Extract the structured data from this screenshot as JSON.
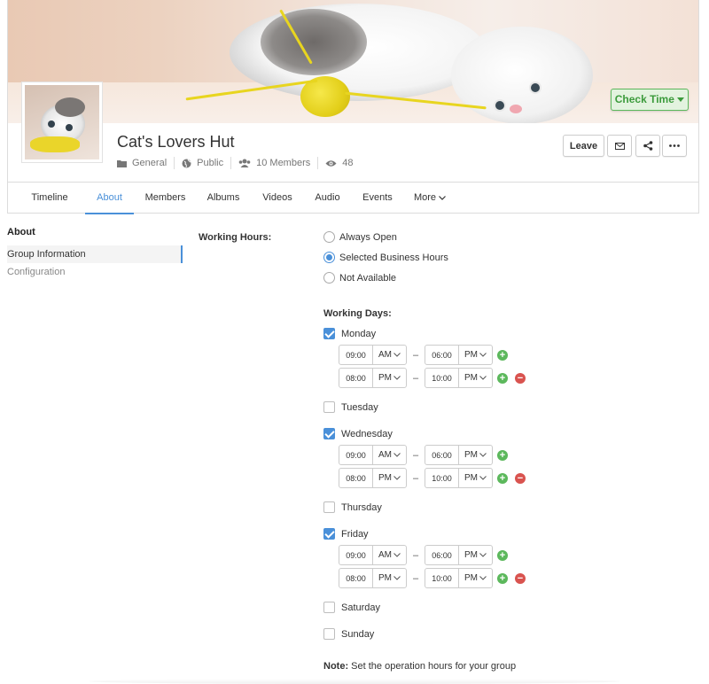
{
  "header": {
    "check_time_label": "Check Time",
    "group_title": "Cat's Lovers Hut",
    "meta": {
      "category": "General",
      "privacy": "Public",
      "members": "10 Members",
      "views": "48"
    },
    "actions": {
      "leave_label": "Leave"
    },
    "tabs": [
      {
        "label": "Timeline"
      },
      {
        "label": "About",
        "active": true
      },
      {
        "label": "Members"
      },
      {
        "label": "Albums"
      },
      {
        "label": "Videos"
      },
      {
        "label": "Audio"
      },
      {
        "label": "Events"
      },
      {
        "label": "More"
      }
    ]
  },
  "sidebar": {
    "title": "About",
    "items": [
      {
        "label": "Group Information",
        "active": true
      },
      {
        "label": "Configuration"
      }
    ]
  },
  "form": {
    "working_hours_label": "Working Hours:",
    "working_hours_options": [
      {
        "label": "Always Open",
        "selected": false
      },
      {
        "label": "Selected Business Hours",
        "selected": true
      },
      {
        "label": "Not Available",
        "selected": false
      }
    ],
    "working_days_label": "Working Days:",
    "days": [
      {
        "label": "Monday",
        "checked": true,
        "slots": [
          {
            "start": "09:00",
            "start_ampm": "AM",
            "end": "06:00",
            "end_ampm": "PM"
          },
          {
            "start": "08:00",
            "start_ampm": "PM",
            "end": "10:00",
            "end_ampm": "PM"
          }
        ]
      },
      {
        "label": "Tuesday",
        "checked": false,
        "slots": []
      },
      {
        "label": "Wednesday",
        "checked": true,
        "slots": [
          {
            "start": "09:00",
            "start_ampm": "AM",
            "end": "06:00",
            "end_ampm": "PM"
          },
          {
            "start": "08:00",
            "start_ampm": "PM",
            "end": "10:00",
            "end_ampm": "PM"
          }
        ]
      },
      {
        "label": "Thursday",
        "checked": false,
        "slots": []
      },
      {
        "label": "Friday",
        "checked": true,
        "slots": [
          {
            "start": "09:00",
            "start_ampm": "AM",
            "end": "06:00",
            "end_ampm": "PM"
          },
          {
            "start": "08:00",
            "start_ampm": "PM",
            "end": "10:00",
            "end_ampm": "PM"
          }
        ]
      },
      {
        "label": "Saturday",
        "checked": false,
        "slots": []
      },
      {
        "label": "Sunday",
        "checked": false,
        "slots": []
      }
    ],
    "note_label": "Note:",
    "note_text": "Set the operation hours for your group"
  },
  "colors": {
    "accent": "#4a90d9",
    "add": "#5cb85c",
    "remove": "#d9534f",
    "check_time_text": "#3c9b3c"
  },
  "icons": [
    "folder-icon",
    "globe-icon",
    "users-icon",
    "eye-icon",
    "mail-icon",
    "share-icon",
    "ellipsis-icon",
    "caret-down-icon",
    "chevron-down-icon",
    "plus-circle-icon",
    "minus-circle-icon"
  ]
}
